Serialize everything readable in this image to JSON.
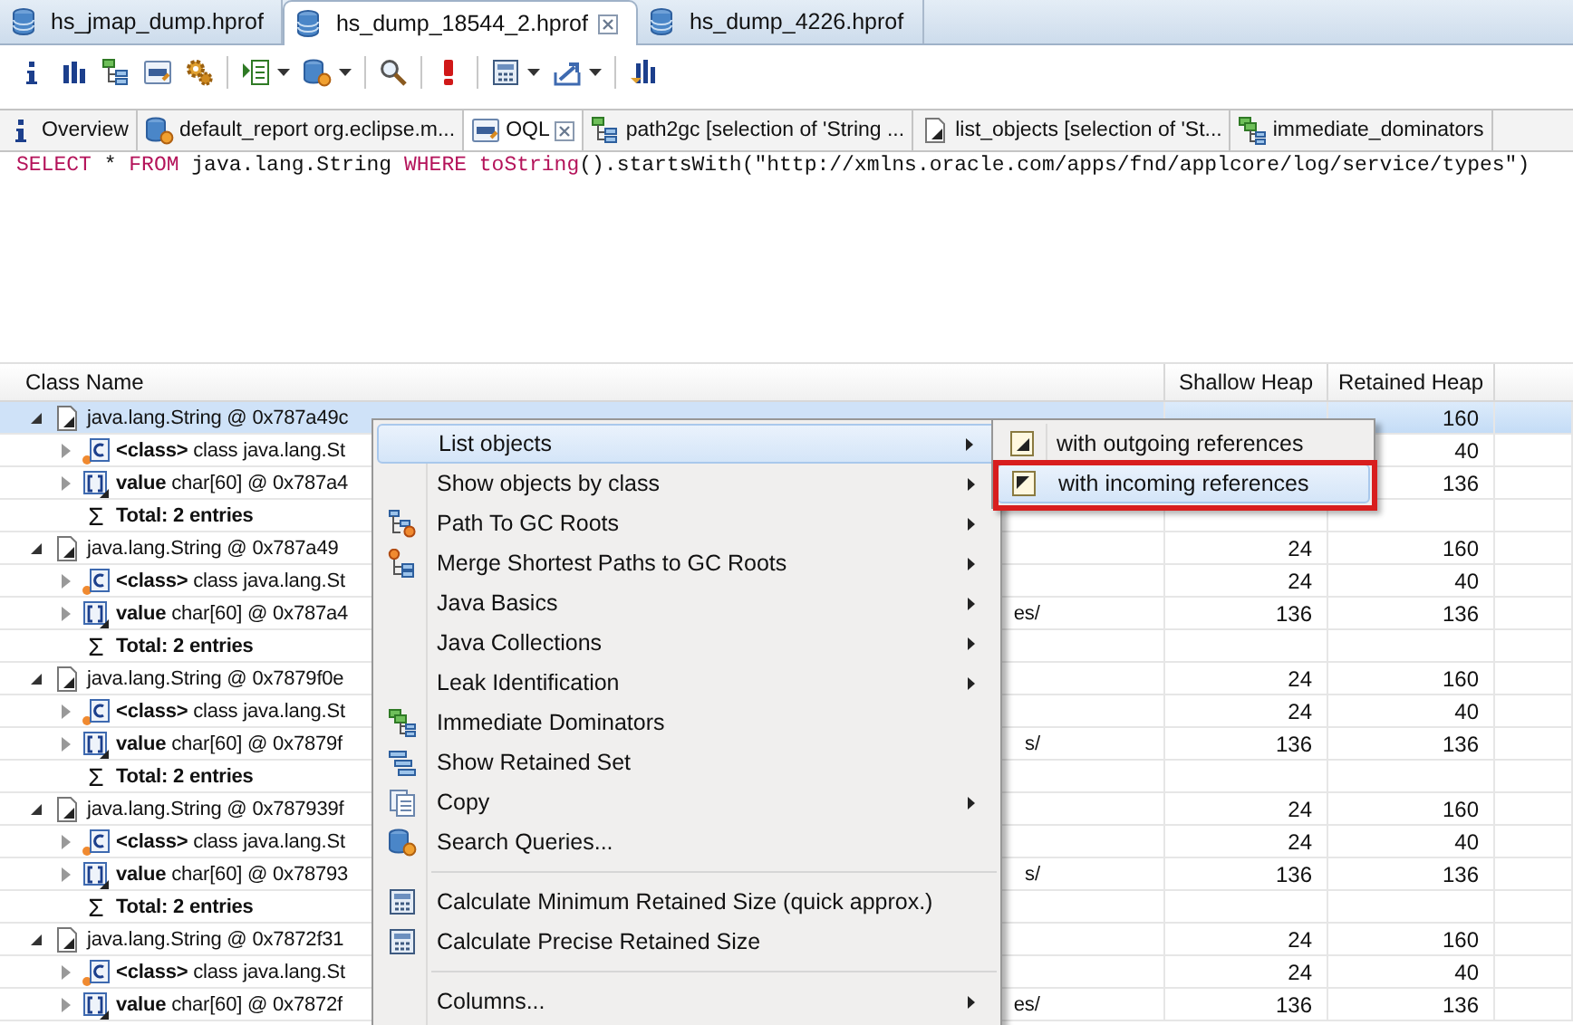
{
  "editor_tabs": [
    {
      "label": "hs_jmap_dump.hprof",
      "selected": false
    },
    {
      "label": "hs_dump_18544_2.hprof",
      "selected": true
    },
    {
      "label": "hs_dump_4226.hprof",
      "selected": false
    }
  ],
  "toolbar": [
    {
      "kind": "info",
      "dropdown": false
    },
    {
      "kind": "histogram",
      "dropdown": false
    },
    {
      "kind": "tree",
      "dropdown": false
    },
    {
      "kind": "oql",
      "dropdown": false
    },
    {
      "kind": "gears",
      "dropdown": false
    },
    {
      "kind": "separator"
    },
    {
      "kind": "list",
      "dropdown": true
    },
    {
      "kind": "database",
      "dropdown": true
    },
    {
      "kind": "separator"
    },
    {
      "kind": "search",
      "dropdown": false
    },
    {
      "kind": "separator"
    },
    {
      "kind": "alert",
      "dropdown": false
    },
    {
      "kind": "separator"
    },
    {
      "kind": "calculator",
      "dropdown": true
    },
    {
      "kind": "export",
      "dropdown": true
    },
    {
      "kind": "separator"
    },
    {
      "kind": "chart",
      "dropdown": false
    }
  ],
  "result_tabs": [
    {
      "label": "Overview",
      "kind": "info",
      "selected": false
    },
    {
      "label": "default_report  org.eclipse.m...",
      "kind": "database",
      "selected": false
    },
    {
      "label": "OQL",
      "kind": "oql",
      "selected": true
    },
    {
      "label": "path2gc [selection of 'String ...",
      "kind": "tree",
      "selected": false
    },
    {
      "label": "list_objects [selection of 'St...",
      "kind": "object",
      "selected": false
    },
    {
      "label": "immediate_dominators",
      "kind": "dominators",
      "selected": false
    }
  ],
  "query": [
    {
      "text": "SELECT",
      "kind": "keyword"
    },
    {
      "text": " * ",
      "kind": "plain"
    },
    {
      "text": "FROM",
      "kind": "keyword"
    },
    {
      "text": " java.lang.String ",
      "kind": "plain"
    },
    {
      "text": "WHERE toString",
      "kind": "keyword"
    },
    {
      "text": "().startsWith(\"http://xmlns.oracle.com/apps/fnd/applcore/log/service/types\")",
      "kind": "plain"
    }
  ],
  "table": {
    "columns": [
      "Class Name",
      "Shallow Heap",
      "Retained Heap"
    ],
    "rows": [
      {
        "kind": "object",
        "name": "java.lang.String @ 0x787a49c",
        "retained": "160",
        "selected": true,
        "expanded": true,
        "children": [
          {
            "kind": "class",
            "name": "**<class>** class java.lang.St",
            "retained": "40",
            "selected": false,
            "expanded": false
          },
          {
            "kind": "value",
            "name": "**value** char[60] @ 0x787a4",
            "retained": "136",
            "selected": false,
            "expanded": false
          },
          {
            "kind": "total",
            "symbol": "Σ",
            "name": "Total: 2 entries",
            "selected": false
          }
        ]
      },
      {
        "kind": "object",
        "name": "java.lang.String @ 0x787a49",
        "shallow": "24",
        "retained": "160",
        "selected": false,
        "expanded": true,
        "children": [
          {
            "kind": "class",
            "name": "**<class>** class java.lang.St",
            "shallow": "24",
            "retained": "40",
            "selected": false,
            "expanded": false
          },
          {
            "kind": "value",
            "name": "**value** char[60] @ 0x787a4",
            "tail": "es/",
            "shallow": "136",
            "retained": "136",
            "selected": false,
            "expanded": false
          },
          {
            "kind": "total",
            "symbol": "Σ",
            "name": "Total: 2 entries",
            "selected": false
          }
        ]
      },
      {
        "kind": "object",
        "name": "java.lang.String @ 0x7879f0e",
        "shallow": "24",
        "retained": "160",
        "selected": false,
        "expanded": true,
        "children": [
          {
            "kind": "class",
            "name": "**<class>** class java.lang.St",
            "shallow": "24",
            "retained": "40",
            "selected": false,
            "expanded": false
          },
          {
            "kind": "value",
            "name": "**value** char[60] @ 0x7879f",
            "tail": "s/",
            "shallow": "136",
            "retained": "136",
            "selected": false,
            "expanded": false
          },
          {
            "kind": "total",
            "symbol": "Σ",
            "name": "Total: 2 entries",
            "selected": false
          }
        ]
      },
      {
        "kind": "object",
        "name": "java.lang.String @ 0x787939f",
        "shallow": "24",
        "retained": "160",
        "selected": false,
        "expanded": true,
        "children": [
          {
            "kind": "class",
            "name": "**<class>** class java.lang.St",
            "shallow": "24",
            "retained": "40",
            "selected": false,
            "expanded": false
          },
          {
            "kind": "value",
            "name": "**value** char[60] @ 0x78793",
            "tail": "s/",
            "shallow": "136",
            "retained": "136",
            "selected": false,
            "expanded": false
          },
          {
            "kind": "total",
            "symbol": "Σ",
            "name": "Total: 2 entries",
            "selected": false
          }
        ]
      },
      {
        "kind": "object",
        "name": "java.lang.String @ 0x7872f31",
        "shallow": "24",
        "retained": "160",
        "selected": false,
        "expanded": true,
        "children": [
          {
            "kind": "class",
            "name": "**<class>** class java.lang.St",
            "shallow": "24",
            "retained": "40",
            "selected": false,
            "expanded": false
          },
          {
            "kind": "value",
            "name": "**value** char[60] @ 0x7872f",
            "tail": "es/",
            "shallow": "136",
            "retained": "136",
            "selected": false,
            "expanded": false
          }
        ]
      }
    ]
  },
  "context_menu": {
    "items": [
      {
        "kind": "plain",
        "label": "List objects",
        "submenu": true,
        "highlighted": true
      },
      {
        "kind": "plain",
        "label": "Show objects by class",
        "submenu": true,
        "highlighted": false
      },
      {
        "kind": "path",
        "label": "Path To GC Roots",
        "submenu": true,
        "highlighted": false
      },
      {
        "kind": "merge",
        "label": "Merge Shortest Paths to GC Roots",
        "submenu": true,
        "highlighted": false
      },
      {
        "kind": "plain",
        "label": "Java Basics",
        "submenu": true,
        "highlighted": false
      },
      {
        "kind": "plain",
        "label": "Java Collections",
        "submenu": true,
        "highlighted": false
      },
      {
        "kind": "plain",
        "label": "Leak Identification",
        "submenu": true,
        "highlighted": false
      },
      {
        "kind": "dominators",
        "label": "Immediate Dominators",
        "submenu": false,
        "highlighted": false
      },
      {
        "kind": "retained",
        "label": "Show Retained Set",
        "submenu": false,
        "highlighted": false
      },
      {
        "kind": "copy",
        "label": "Copy",
        "submenu": true,
        "highlighted": false
      },
      {
        "kind": "database",
        "label": "Search Queries...",
        "submenu": false,
        "highlighted": false
      },
      {
        "kind": "separator"
      },
      {
        "kind": "calculator",
        "label": "Calculate Minimum Retained Size (quick approx.)",
        "submenu": false,
        "highlighted": false
      },
      {
        "kind": "calculator",
        "label": "Calculate Precise Retained Size",
        "submenu": false,
        "highlighted": false
      },
      {
        "kind": "separator"
      },
      {
        "kind": "plain",
        "label": "Columns...",
        "submenu": true,
        "highlighted": false
      }
    ],
    "submenu": [
      {
        "label": "with outgoing references",
        "kind": "outgoing",
        "selected": false,
        "outlined": false
      },
      {
        "label": "with incoming references",
        "kind": "incoming",
        "selected": true,
        "outlined": true
      }
    ]
  }
}
